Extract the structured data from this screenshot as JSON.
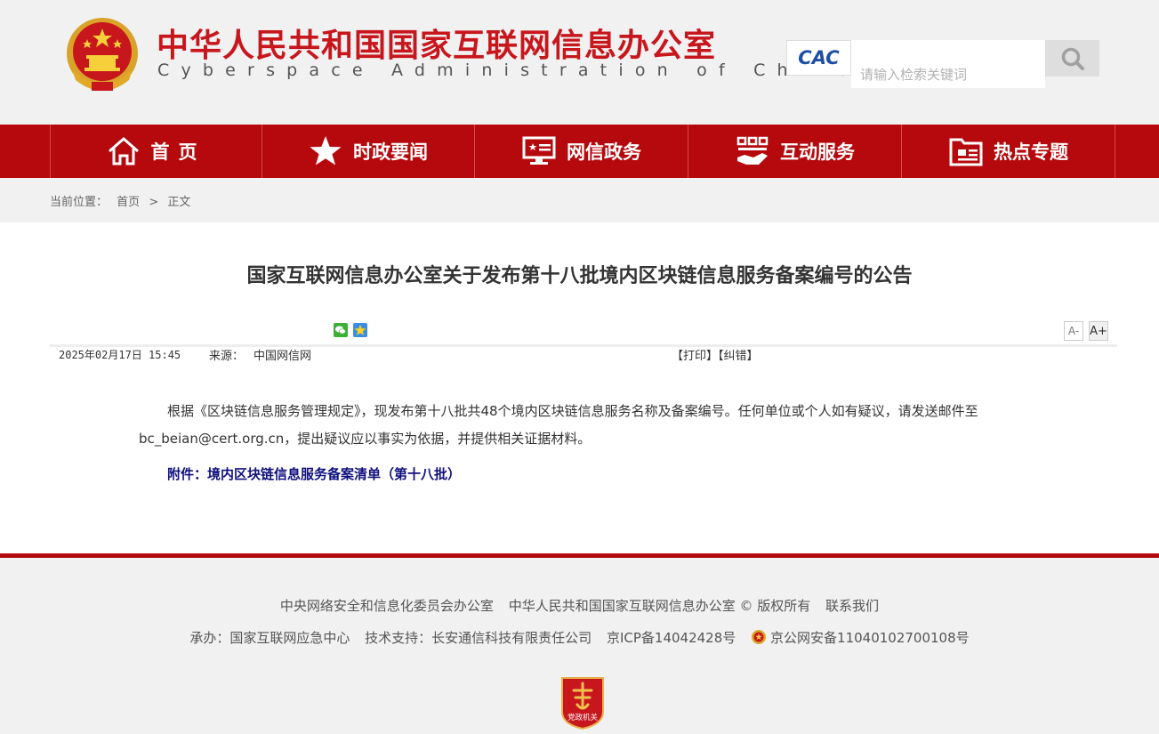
{
  "header": {
    "site_name_cn": "中华人民共和国国家互联网信息办公室",
    "site_name_en": "Cyberspace Administration of China",
    "logo_text": "CAC",
    "search_placeholder": "请输入检索关键词"
  },
  "nav": {
    "items": [
      {
        "label": "首页",
        "icon": "home-icon",
        "active": true
      },
      {
        "label": "时政要闻",
        "icon": "star-icon",
        "active": false
      },
      {
        "label": "网信政务",
        "icon": "monitor-icon",
        "active": false
      },
      {
        "label": "互动服务",
        "icon": "service-icon",
        "active": false
      },
      {
        "label": "热点专题",
        "icon": "folder-icon",
        "active": false
      }
    ]
  },
  "breadcrumb": {
    "prefix": "当前位置：",
    "items": [
      "首页",
      "正文"
    ],
    "separator": ">"
  },
  "article": {
    "title": "国家互联网信息办公室关于发布第十八批境内区块链信息服务备案编号的公告",
    "date": "2025年02月17日 15:45",
    "source_label": "来源：",
    "source": "中国网信网",
    "print_label": "【打印】",
    "error_label": "【纠错】",
    "font_small": "A-",
    "font_large": "A+",
    "body": "根据《区块链信息服务管理规定》，现发布第十八批共48个境内区块链信息服务名称及备案编号。任何单位或个人如有疑议，请发送邮件至bc_beian@cert.org.cn，提出疑议应以事实为依据，并提供相关证据材料。",
    "attachment": "附件：境内区块链信息服务备案清单（第十八批）"
  },
  "footer": {
    "line1": [
      "中央网络安全和信息化委员会办公室",
      "中华人民共和国国家互联网信息办公室 © 版权所有",
      "联系我们"
    ],
    "line2": [
      "承办：国家互联网应急中心",
      "技术支持：长安通信科技有限责任公司",
      "京ICP备14042428号",
      "京公网安备11040102700108号"
    ],
    "badge_text": "党政机关"
  },
  "colors": {
    "brand_red": "#b6090d",
    "title_red": "#c8161d",
    "attachment_blue": "#10107e"
  }
}
